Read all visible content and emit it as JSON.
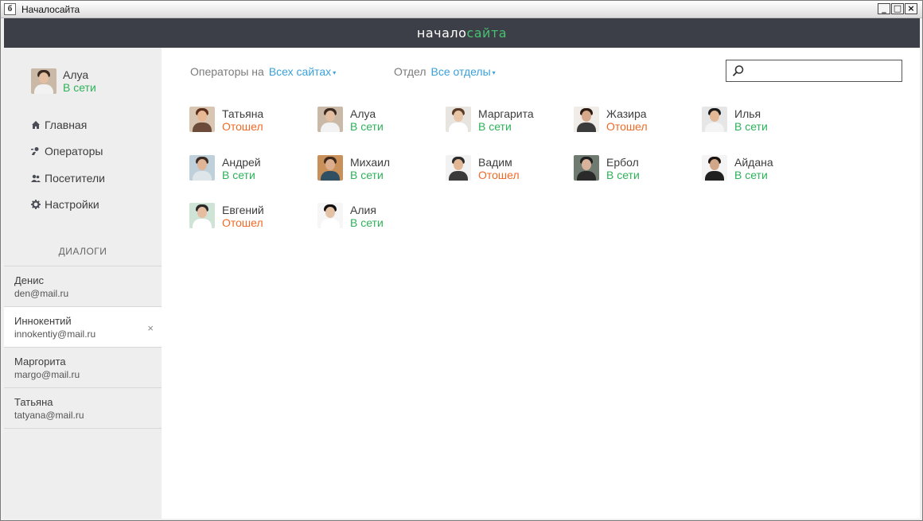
{
  "window": {
    "title": "Началосайта"
  },
  "app": {
    "logo_part1": "начало",
    "logo_part2": "сайта"
  },
  "user": {
    "name": "Алуа",
    "status": "В сети"
  },
  "nav": [
    {
      "label": "Главная",
      "icon": "home-icon"
    },
    {
      "label": "Операторы",
      "icon": "operators-icon"
    },
    {
      "label": "Посетители",
      "icon": "visitors-icon"
    },
    {
      "label": "Настройки",
      "icon": "gear-icon"
    }
  ],
  "dialogs": {
    "title": "ДИАЛОГИ",
    "items": [
      {
        "name": "Денис",
        "email": "den@mail.ru"
      },
      {
        "name": "Иннокентий",
        "email": "innokentiy@mail.ru",
        "close": "×"
      },
      {
        "name": "Маргорита",
        "email": "margo@mail.ru"
      },
      {
        "name": "Татьяна",
        "email": "tatyana@mail.ru"
      }
    ]
  },
  "filters": {
    "operators_label": "Операторы на",
    "operators_value": "Всех сайтах",
    "dept_label": "Отдел",
    "dept_value": "Все отделы",
    "caret": "▾"
  },
  "search": {
    "placeholder": ""
  },
  "operators": [
    {
      "name": "Татьяна",
      "status": "Отошел",
      "state": "away"
    },
    {
      "name": "Алуа",
      "status": "В сети",
      "state": "online"
    },
    {
      "name": "Маргарита",
      "status": "В сети",
      "state": "online"
    },
    {
      "name": "Жазира",
      "status": "Отошел",
      "state": "away"
    },
    {
      "name": "Илья",
      "status": "В сети",
      "state": "online"
    },
    {
      "name": "Андрей",
      "status": "В сети",
      "state": "online"
    },
    {
      "name": "Михаил",
      "status": "В сети",
      "state": "online"
    },
    {
      "name": "Вадим",
      "status": "Отошел",
      "state": "away"
    },
    {
      "name": "Ербол",
      "status": "В сети",
      "state": "online"
    },
    {
      "name": "Айдана",
      "status": "В сети",
      "state": "online"
    },
    {
      "name": "Евгений",
      "status": "Отошел",
      "state": "away"
    },
    {
      "name": "Алия",
      "status": "В сети",
      "state": "online"
    }
  ],
  "colors": {
    "online": "#2eb25a",
    "away": "#ef6a27",
    "link": "#3aa1d8",
    "header": "#3c3f47",
    "logo_accent": "#46c270"
  }
}
